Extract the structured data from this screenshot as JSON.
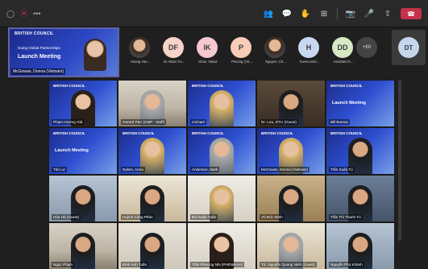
{
  "topbar": {
    "left_icons": [
      "shield-icon",
      "record-icon",
      "more-icon"
    ],
    "left_glyphs": [
      "◯",
      "⦿",
      "•••"
    ],
    "right_icons": [
      "people-icon",
      "chat-icon",
      "react-icon",
      "view-icon",
      "camera-icon",
      "mic-icon",
      "share-icon"
    ],
    "right_glyphs": [
      "👥",
      "💬",
      "✋",
      "⊞",
      "📷",
      "🎤",
      "⇧"
    ],
    "leave_glyph": "☎"
  },
  "presenter": {
    "logo": "BRITISH COUNCIL",
    "subtitle": "Going Global Partnerships",
    "title": "Launch Meeting",
    "name": "McGowan, Donna (Vietnam)"
  },
  "participants": [
    {
      "initials": "",
      "name": "Hoang Van...",
      "color": "",
      "photo": true
    },
    {
      "initials": "DF",
      "name": "Dr Alison Fe...",
      "color": "#f6d2c8",
      "photo": false
    },
    {
      "initials": "IK",
      "name": "Khan, Imtiaz",
      "color": "#f5c7cf",
      "photo": false
    },
    {
      "initials": "P",
      "name": "Phuong (VK...",
      "color": "#f8cdb8",
      "photo": false
    },
    {
      "initials": "",
      "name": "Nguyen, Ch...",
      "color": "",
      "photo": true
    },
    {
      "initials": "H",
      "name": "huent.enkd...",
      "color": "#c8d8f0",
      "photo": false
    },
    {
      "initials": "DD",
      "name": "Assistant D...",
      "color": "#d6e8c4",
      "photo": false
    }
  ],
  "more_count": "+60",
  "self": {
    "initials": "DT"
  },
  "gallery": [
    {
      "name": "Phạm Hương Giả",
      "bg": "slide-head-h1"
    },
    {
      "name": "Gerard Parr (CMP - Staff)",
      "bg": "room-h2"
    },
    {
      "name": "michael",
      "bg": "slide-head-h3"
    },
    {
      "name": "Dr. Lưu, DTU (Guest)",
      "bg": "room3-h4"
    },
    {
      "name": "Bill Burson",
      "bg": "slide"
    },
    {
      "name": "Tôn Lư",
      "bg": "slide"
    },
    {
      "name": "Dykes, Anna",
      "bg": "slide-head-h3"
    },
    {
      "name": "Anderson, Mark",
      "bg": "slide-head-h2"
    },
    {
      "name": "McGowan, Donna (Vietnam)",
      "bg": "slide-head-h3"
    },
    {
      "name": "Trần Xuân Tú",
      "bg": "slide-head-h4"
    },
    {
      "name": "Hòa Hà (Guest)",
      "bg": "room4-h4"
    },
    {
      "name": "Huỳnh Công Phán",
      "bg": "room5-h4"
    },
    {
      "name": "Bùi Xuân Tuấn",
      "bg": "room6-h3"
    },
    {
      "name": "Vũ Đức Minh",
      "bg": "room7-h4"
    },
    {
      "name": "Trần Thị Thanh Tú",
      "bg": "room8-h4"
    },
    {
      "name": "Ngọc Phạm",
      "bg": "room-h4"
    },
    {
      "name": "Đinh Anh Tuấn",
      "bg": "room2-h4"
    },
    {
      "name": "Trần Phương Nhi (PHENIKAA)",
      "bg": "room6-h1"
    },
    {
      "name": "TS. Nguyễn Quang Ninh (Guest)",
      "bg": "room5-h2"
    },
    {
      "name": "Nguyễn Phú Khánh",
      "bg": "room4-h4"
    }
  ],
  "slide": {
    "logo": "BRITISH COUNCIL",
    "title": "Launch Meeting"
  }
}
